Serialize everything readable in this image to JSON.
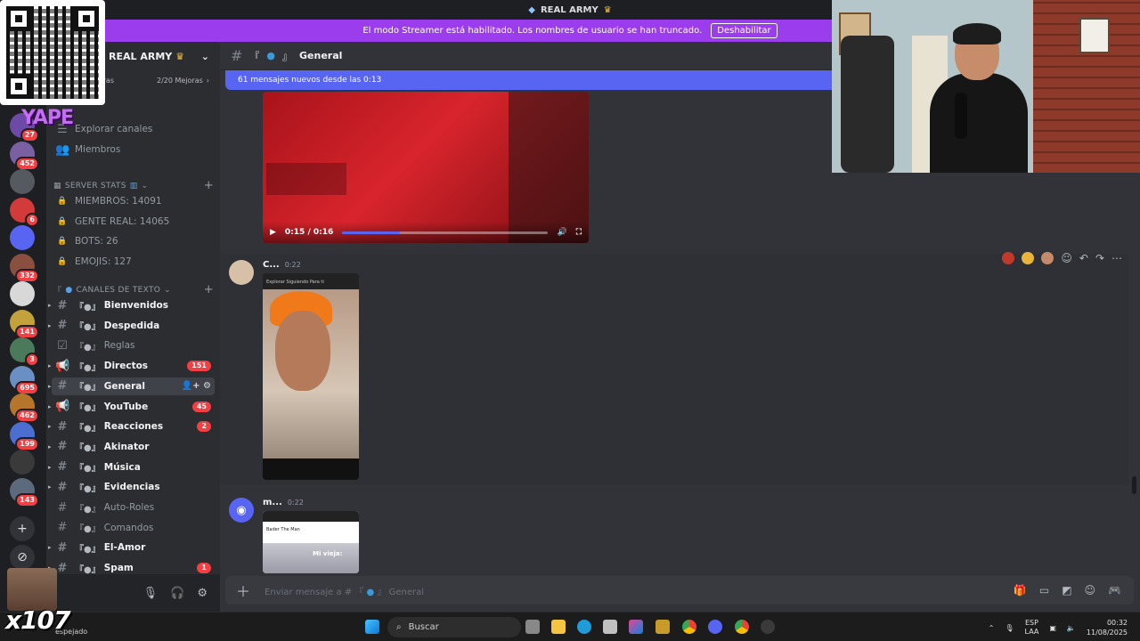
{
  "window": {
    "title": "REAL ARMY",
    "title_icon": "diamond-icon",
    "title_suffix_icon": "crown-icon"
  },
  "streamer_banner": {
    "text": "El modo Streamer está habilitado. Los nombres de usuario se han truncado.",
    "button": "Deshabilitar",
    "color": "#9b3ded"
  },
  "server": {
    "name": "REAL ARMY",
    "boosts": "2/20 Mejoras",
    "boost_prefix": "eras"
  },
  "server_rail": [
    {
      "color": "#6d4aa8",
      "badge": "27"
    },
    {
      "color": "#7a5fa3",
      "badge": "452"
    },
    {
      "color": "#555a60",
      "badge": ""
    },
    {
      "color": "#d33a3a",
      "badge": "6"
    },
    {
      "color": "#5865f2",
      "badge": ""
    },
    {
      "color": "#8a4f3f",
      "badge": "332"
    },
    {
      "color": "#d8d8d8",
      "badge": ""
    },
    {
      "color": "#c3a23b",
      "badge": "141"
    },
    {
      "color": "#4a7a5a",
      "badge": "3"
    },
    {
      "color": "#6a8fc2",
      "badge": "695"
    },
    {
      "color": "#b5762c",
      "badge": "462"
    },
    {
      "color": "#4c6ed0",
      "badge": "199"
    },
    {
      "color": "#3a3a3a",
      "badge": ""
    },
    {
      "color": "#5b6a7c",
      "badge": "143"
    }
  ],
  "sidebar": {
    "explore": "Explorar canales",
    "members": "Miembros",
    "stats_category": "SERVER STATS",
    "stats": [
      "MIEMBROS: 14091",
      "GENTE REAL: 14065",
      "BOTS: 26",
      "EMOJIS: 127"
    ],
    "text_category": "CANALES DE TEXTO",
    "channels": [
      {
        "name": "Bienvenidos",
        "badge": "",
        "bright": true
      },
      {
        "name": "Despedida",
        "badge": "",
        "bright": true
      },
      {
        "name": "Reglas",
        "badge": "",
        "bright": false
      },
      {
        "name": "Directos",
        "badge": "151",
        "bright": true
      },
      {
        "name": "General",
        "badge": "",
        "bright": true,
        "active": true
      },
      {
        "name": "YouTube",
        "badge": "45",
        "bright": true
      },
      {
        "name": "Reacciones",
        "badge": "2",
        "bright": true
      },
      {
        "name": "Akinator",
        "badge": "",
        "bright": true
      },
      {
        "name": "Música",
        "badge": "",
        "bright": true
      },
      {
        "name": "Evidencias",
        "badge": "",
        "bright": true
      },
      {
        "name": "Auto-Roles",
        "badge": "",
        "bright": false
      },
      {
        "name": "Comandos",
        "badge": "",
        "bright": false
      },
      {
        "name": "El-Amor",
        "badge": "",
        "bright": true
      },
      {
        "name": "Spam",
        "badge": "1",
        "bright": true
      }
    ]
  },
  "channel": {
    "name": "General",
    "new_messages": "61 mensajes nuevos desde las 0:13"
  },
  "messages": [
    {
      "video_time": "0:15 / 0:16",
      "progress": 0.28
    },
    {
      "author": "C...",
      "time": "0:22",
      "phone_caption": "Explorar  Siguiendo  Para ti"
    },
    {
      "author": "m...",
      "time": "0:22",
      "phone_caption": "Mi vieja:",
      "phone_top": "Bader The Man"
    }
  ],
  "composer": {
    "placeholder": "Enviar mensaje a #",
    "channel": "General"
  },
  "overlays": {
    "yape": "YAPE",
    "multiplier": "x107"
  },
  "taskbar": {
    "weather": "espejado",
    "search": "Buscar",
    "lang_top": "ESP",
    "lang_bottom": "LAA",
    "time": "00:32",
    "date": "11/08/2025"
  }
}
